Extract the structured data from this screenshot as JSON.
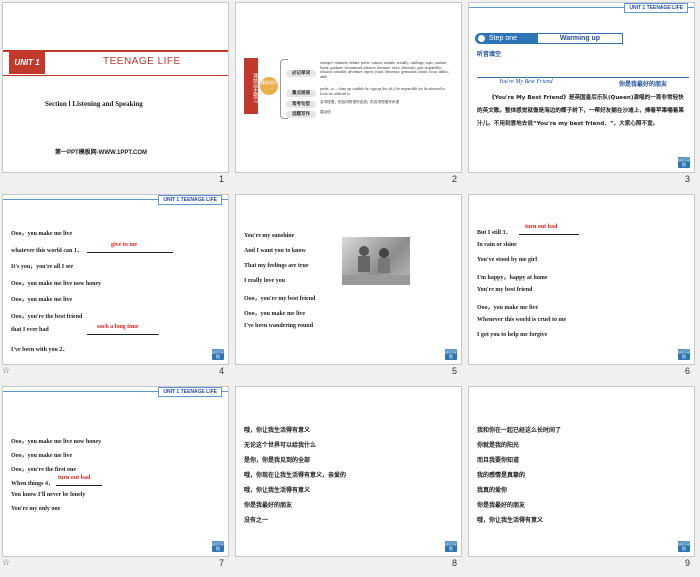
{
  "unit_header": "UNIT 1   TEENAGE LIFE",
  "nav_label": "返回导航",
  "slide1": {
    "unit_tag": "UNIT 1",
    "title": "TEENAGE LIFE",
    "section": "Section Ⅰ  Listening and Speaking",
    "footer": "第一PPT模板网-WWW.1PPT.COM",
    "number": "1"
  },
  "slide2": {
    "side_title": "课前自主预习",
    "side_badge": "基础知识",
    "items": [
      {
        "label": "必记单词",
        "text": "teenager; volunteer; debate; prefer; content; suitable; actually; challenge; topic; confuse; fluent; graduate; recommend; advance; literature; extra; obviously; quit; responsible; solution; schedule; adventure; expert; youth; behaviour; generation; attract; focus; addict; adult"
      },
      {
        "label": "重点短语",
        "text": "prefer...to...; clean up; suitable for; sign up (for sth.); be responsible for; be attracted to; focus on; addicted to"
      },
      {
        "label": "常考句型",
        "text": "名词短语；形容词短语作定语；形容词短语作状语"
      },
      {
        "label": "话题写作",
        "text": "建议信"
      }
    ],
    "number": "2"
  },
  "slide3": {
    "step_label": "Step one",
    "step_title": "Warming up",
    "sub": "听音填空",
    "song_en": "You're My Best Friend",
    "song_cn": "你是我最好的朋友",
    "para": "《You're My Best Friend》是英国皇后乐队(Queen)演唱的一首非常轻快的英文歌。整体感觉就像是海边的椰子树下，一帮好友躺在沙滩上，捧着苹果嚼着果汁儿。不用刻意地去说“You're my best friend．”，大家心照不宣。",
    "number": "3"
  },
  "slide4": {
    "lines": [
      "Ooo，you make me live",
      "whatever this world can 1．",
      "It's you，you're all I see",
      "Ooo，you make me live now honey",
      "Ooo，you make me live",
      "Ooo，you're the best friend",
      "that I ever had",
      "I've been with you 2．"
    ],
    "answers": [
      "give to me",
      "such a long time"
    ],
    "number": "4"
  },
  "slide5": {
    "lines": [
      "You're my sunshine",
      "And I want you to know",
      "That my feelings are true",
      "I really love you",
      "Ooo，you're my best friend",
      "Ooo，you make me live",
      "I've been wandering round"
    ],
    "number": "5"
  },
  "slide6": {
    "lines": [
      "But I still 3．",
      "In rain or shine",
      "You've stood by me girl",
      "I'm happy，happy at home",
      "You're my best friend",
      "Ooo，you make me live",
      "Whenever this world is cruel to me",
      "I got you to help me forgive"
    ],
    "answers": [
      "turn out bad"
    ],
    "number": "6"
  },
  "slide7": {
    "lines": [
      "Ooo，you make me live now honey",
      "Ooo，you make me live",
      "Ooo，you're the first one",
      "When things 4．",
      "You know I'll never be lonely",
      "You're my only one"
    ],
    "answers": [
      "turn out bad"
    ],
    "number": "7"
  },
  "slide8": {
    "lines": [
      "哦，你让我生活得有意义",
      "无论这个世界可以给我什么",
      "是你，你是我见到的全部",
      "哦，你现在让我生活得有意义，亲爱的",
      "哦，你让我生活得有意义",
      "你是我最好的朋友",
      "没有之一"
    ],
    "number": "8"
  },
  "slide9": {
    "lines": [
      "我和你在一起已经这么长时间了",
      "你就是我的阳光",
      "而且我要你知道",
      "我的感情是真挚的",
      "我真的爱你",
      "你是我最好的朋友",
      "哦，你让我生活得有意义"
    ],
    "number": "9"
  },
  "colors": {
    "accent_blue": "#2e75b6",
    "answer_red": "#e02020",
    "title_red": "#c0392b"
  }
}
